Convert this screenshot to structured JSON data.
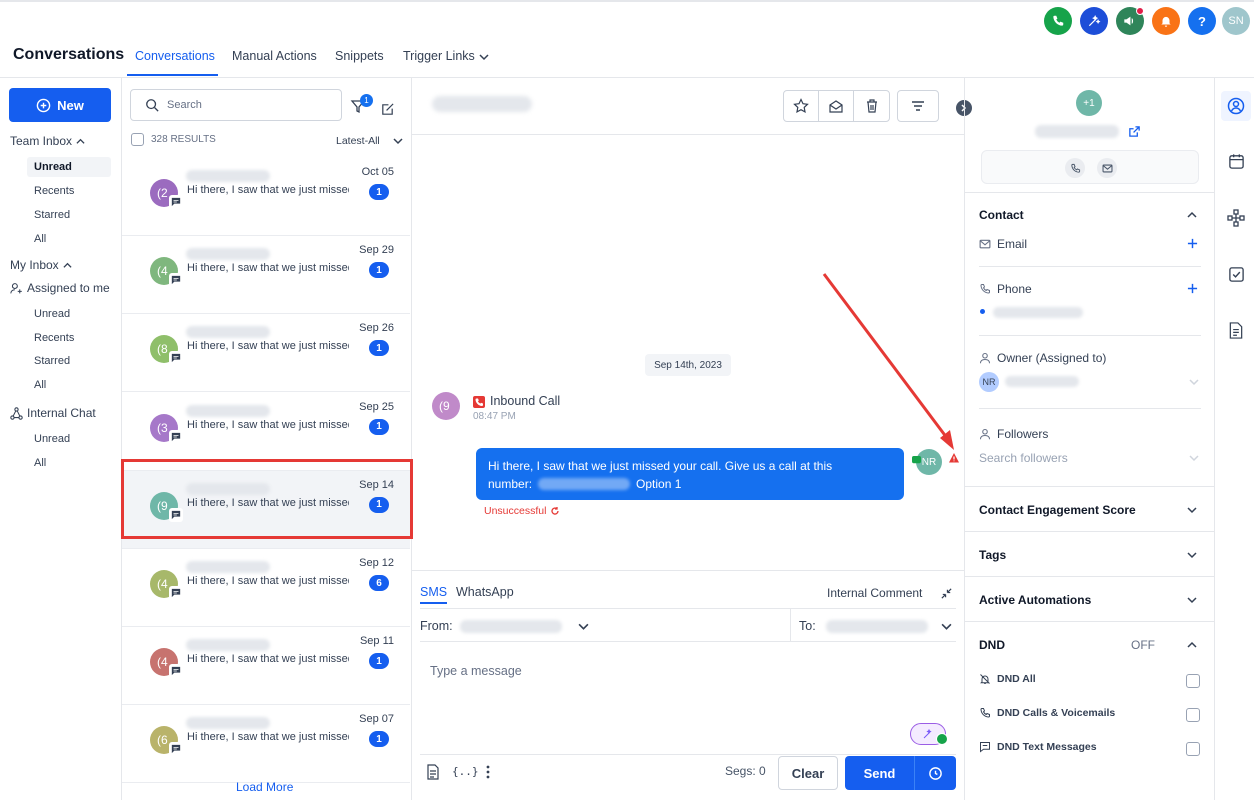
{
  "topbar": {
    "icons": [
      {
        "name": "phone-icon",
        "color": "#16a34a"
      },
      {
        "name": "magic-sparkle-icon",
        "color": "#1d4ed8"
      },
      {
        "name": "megaphone-icon",
        "color": "#2f855a"
      },
      {
        "name": "bell-icon",
        "color": "#f97316"
      },
      {
        "name": "help-icon",
        "color": "#1570ef"
      }
    ],
    "help_label": "?",
    "avatar_initials": "SN"
  },
  "nav": {
    "title": "Conversations",
    "tabs": [
      "Conversations",
      "Manual Actions",
      "Snippets",
      "Trigger Links"
    ]
  },
  "left_nav": {
    "new_label": "New",
    "team_inbox": "Team Inbox",
    "team_items": [
      "Unread",
      "Recents",
      "Starred",
      "All"
    ],
    "my_inbox": "My Inbox",
    "assigned_to_me": "Assigned to me",
    "my_items": [
      "Unread",
      "Recents",
      "Starred",
      "All"
    ],
    "internal_chat": "Internal Chat",
    "chat_items": [
      "Unread",
      "All"
    ]
  },
  "conv_list": {
    "search_placeholder": "Search",
    "filter_count": "1",
    "results_label": "328 RESULTS",
    "sort_label": "Latest-All",
    "load_more": "Load More",
    "rows": [
      {
        "avatar": "(2",
        "color": "#9b6bbf",
        "date": "Oct 05",
        "count": "1",
        "preview": "Hi there, I saw that we just missed"
      },
      {
        "avatar": "(4",
        "color": "#7fb77e",
        "date": "Sep 29",
        "count": "1",
        "preview": "Hi there, I saw that we just missed"
      },
      {
        "avatar": "(8",
        "color": "#8fbf6a",
        "date": "Sep 26",
        "count": "1",
        "preview": "Hi there, I saw that we just missed"
      },
      {
        "avatar": "(3",
        "color": "#a678c9",
        "date": "Sep 25",
        "count": "1",
        "preview": "Hi there, I saw that we just missed"
      },
      {
        "avatar": "(9",
        "color": "#6fb7a8",
        "date": "Sep 14",
        "count": "1",
        "preview": "Hi there, I saw that we just missed"
      },
      {
        "avatar": "(4",
        "color": "#a7b86a",
        "date": "Sep 12",
        "count": "6",
        "preview": "Hi there, I saw that we just missed"
      },
      {
        "avatar": "(4",
        "color": "#c7736f",
        "date": "Sep 11",
        "count": "1",
        "preview": "Hi there, I saw that we just missed"
      },
      {
        "avatar": "(6",
        "color": "#b9b36a",
        "date": "Sep 07",
        "count": "1",
        "preview": "Hi there, I saw that we just missed"
      }
    ]
  },
  "thread": {
    "date_chip": "Sep 14th, 2023",
    "call_avatar": "(9",
    "call_title": "Inbound Call",
    "call_time": "08:47 PM",
    "message_line1": "Hi there, I saw that we just missed your call. Give us a call at this",
    "message_line2_prefix": "number:",
    "message_line2_suffix": "Option 1",
    "sender_initials": "NR",
    "status": "Unsuccessful"
  },
  "composer": {
    "tabs": [
      "SMS",
      "WhatsApp"
    ],
    "internal_comment": "Internal Comment",
    "from_label": "From:",
    "to_label": "To:",
    "placeholder": "Type a message",
    "segs": "Segs: 0",
    "clear": "Clear",
    "send": "Send",
    "variables_label": "{..}"
  },
  "right_panel": {
    "avatar_label": "+1",
    "contact_title": "Contact",
    "email_label": "Email",
    "phone_label": "Phone",
    "owner_label": "Owner (Assigned to)",
    "owner_initials": "NR",
    "followers_label": "Followers",
    "followers_placeholder": "Search followers",
    "engagement": "Contact Engagement Score",
    "tags": "Tags",
    "automations": "Active Automations",
    "dnd": "DND",
    "dnd_state": "OFF",
    "dnd_items": [
      "DND All",
      "DND Calls & Voicemails",
      "DND Text Messages"
    ]
  },
  "colors": {
    "accent": "#155eef",
    "highlight": "#e53935"
  }
}
